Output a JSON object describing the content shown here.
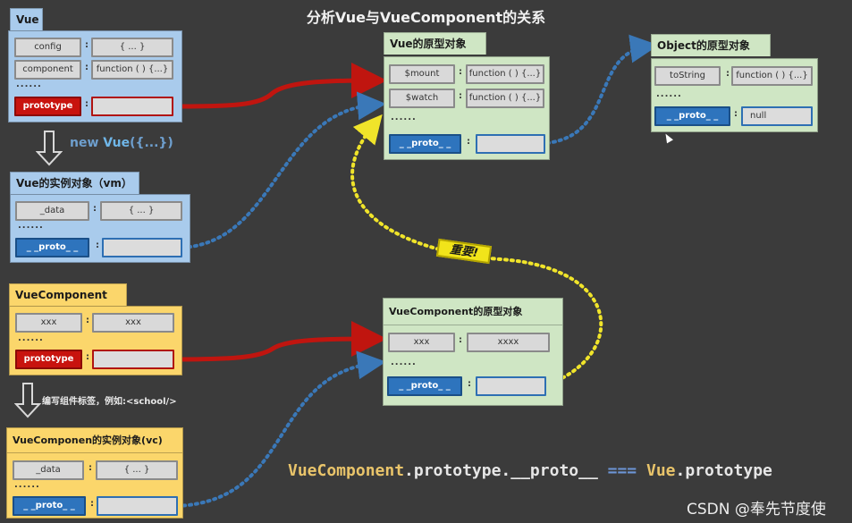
{
  "title": "分析Vue与VueComponent的关系",
  "colors": {
    "background": "#3b3b3b",
    "vue_panel": "#a9cbec",
    "component_panel": "#fbd66b",
    "prototype_panel": "#cfe6c4",
    "prototype_key": "#c8130e",
    "proto_key": "#2e74bd",
    "red_arrow": "#c0150f",
    "blue_dotted": "#3a78b8",
    "yellow_dotted": "#f0e42a"
  },
  "vue": {
    "title": "Vue",
    "rows": [
      {
        "key": "config",
        "value": "{ ... }"
      },
      {
        "key": "component",
        "value": "function ( ) {...}"
      }
    ],
    "ellipsis": "......",
    "prototype_key": "prototype",
    "prototype_value": ""
  },
  "new_vue_label": {
    "prefix": "new ",
    "vue": "Vue",
    "suffix": "({...})"
  },
  "vm": {
    "title": "Vue的实例对象（vm）",
    "rows": [
      {
        "key": "_data",
        "value": "{ ... }"
      }
    ],
    "ellipsis": "......",
    "proto_key": "_ _proto_ _",
    "proto_value": ""
  },
  "vue_prototype": {
    "title": "Vue的原型对象",
    "rows": [
      {
        "key": "$mount",
        "value": "function ( ) {...}"
      },
      {
        "key": "$watch",
        "value": "function ( ) {...}"
      }
    ],
    "ellipsis": "......",
    "proto_key": "_ _proto_ _",
    "proto_value": ""
  },
  "object_prototype": {
    "title": "Object的原型对象",
    "rows": [
      {
        "key": "toString",
        "value": "function ( ) {...}"
      }
    ],
    "ellipsis": "......",
    "proto_key": "_ _proto_ _",
    "proto_value": "null"
  },
  "vue_component": {
    "title": "VueComponent",
    "rows": [
      {
        "key": "xxx",
        "value": "xxx"
      }
    ],
    "ellipsis": "......",
    "prototype_key": "prototype",
    "prototype_value": ""
  },
  "write_tag_label": "编写组件标签，例如:<school/>",
  "vc": {
    "title": "VueComponen的实例对象(vc)",
    "rows": [
      {
        "key": "_data",
        "value": "{ ... }"
      }
    ],
    "ellipsis": "......",
    "proto_key": "_ _proto_ _",
    "proto_value": ""
  },
  "vc_prototype": {
    "title": "VueComponent的原型对象",
    "rows": [
      {
        "key": "xxx",
        "value": "xxxx"
      }
    ],
    "ellipsis": "......",
    "proto_key": "_ _proto_ _",
    "proto_value": ""
  },
  "important_badge": "重要!",
  "formula": {
    "part1": "VueComponent",
    "part2": ".prototype.__proto__ ",
    "op": "===",
    "part3": " Vue",
    "part4": ".prototype"
  },
  "watermark": "CSDN @奉先节度使"
}
